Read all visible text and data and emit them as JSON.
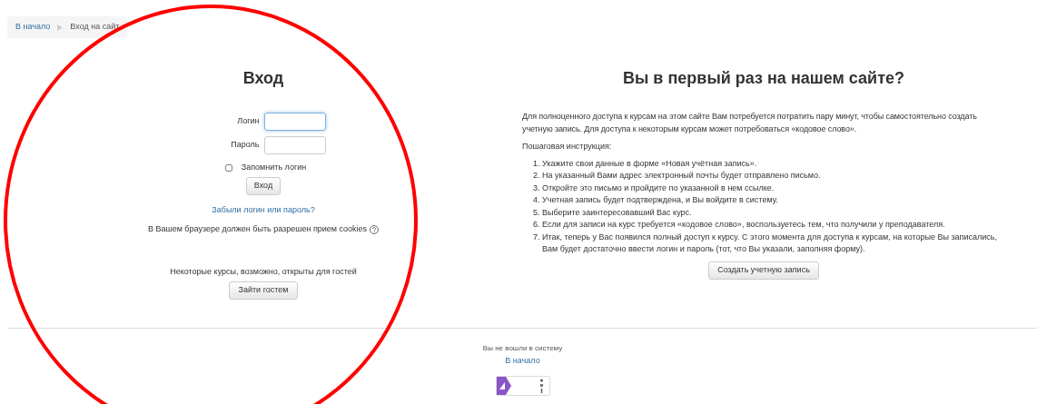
{
  "breadcrumb": [
    {
      "label": "В начало",
      "link": true
    },
    {
      "label": "Вход на сайт",
      "link": false
    }
  ],
  "login": {
    "title": "Вход",
    "fields": [
      {
        "label": "Логин",
        "focused": true
      },
      {
        "label": "Пароль",
        "focused": false
      }
    ],
    "remember": {
      "label": "Запомнить логин",
      "checked": false
    },
    "submit": "Вход",
    "forgot": "Забыли логин или пароль?",
    "cookies": "В Вашем браузере должен быть разрешен прием cookies",
    "guest_note": "Некоторые курсы, возможно, открыты для гостей",
    "guest_button": "Зайти гостем"
  },
  "signup": {
    "title": "Вы в первый раз на нашем сайте?",
    "intro": "Для полноценного доступа к курсам на этом сайте Вам потребуется потратить пару минут, чтобы самостоятельно создать учетную запись. Для доступа к некоторым курсам может потребоваться «кодовое слово».",
    "steps_heading": "Пошаговая инструкция:",
    "steps": [
      {
        "number": "1.",
        "text": "Укажите свои данные в форме «Новая учётная запись»."
      },
      {
        "number": "2.",
        "text": "На указанный Вами адрес электронный почты будет отправлено письмо."
      },
      {
        "number": "3.",
        "text": "Откройте это письмо и пройдите по указанной в нем ссылке."
      },
      {
        "number": "4.",
        "text": "Учетная запись будет подтверждена, и Вы войдите в систему."
      },
      {
        "number": "5.",
        "text": "Выберите заинтересовавший Вас курс."
      },
      {
        "number": "6.",
        "text": "Если для записи на курс требуется «кодовое слово», воспользуетесь тем, что получили у преподавателя."
      },
      {
        "number": "7.",
        "text": "Итак, теперь у Вас появился полный доступ к курсу. С этого момента для доступа к курсам, на которые Вы записались, Вам будет достаточно ввести логин и пароль (тот, что Вы указали, заполняя форму)."
      }
    ],
    "button": "Создать учетную запись"
  },
  "footer": {
    "status": "Вы не вошли в систему",
    "home_link": "В начало"
  }
}
